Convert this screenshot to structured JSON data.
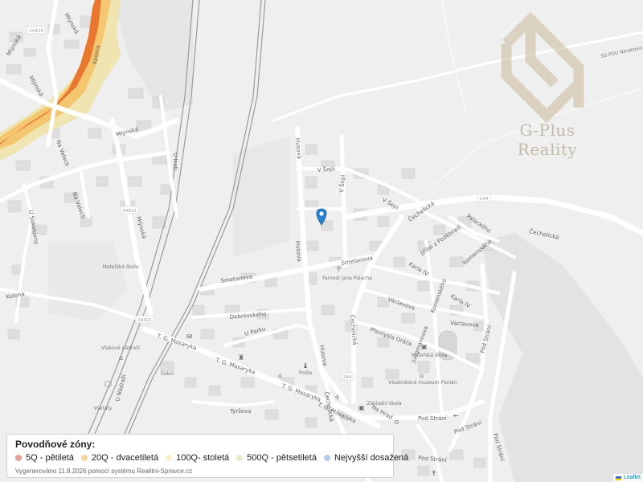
{
  "legend": {
    "title": "Povodňové zóny:",
    "items": [
      {
        "label": "5Q - pětiletá",
        "color": "#e8a19a"
      },
      {
        "label": "20Q - dvacetiletá",
        "color": "#f3d9a0"
      },
      {
        "label": "100Q- stoletá",
        "color": "#f6efc9"
      },
      {
        "label": "500Q - pětsetiletá",
        "color": "#e8e8c7"
      },
      {
        "label": "Nejvyšší dosažená",
        "color": "#b9c9ec"
      }
    ],
    "footer": "Vygenerováno 11.8.2026 pomocí systému Realitni-Spravce.cz"
  },
  "attribution": {
    "label": "Leaflet"
  },
  "logo": {
    "text": "G-Plus Reality",
    "color": "#c9ba9a"
  },
  "map": {
    "marker_icon": "map-pin-icon",
    "colors": {
      "flood_5q": "#e8782f",
      "flood_20q": "#f3c66f",
      "flood_100q": "#f0e3a8",
      "road": "#ffffff",
      "railway": "#9a9a9a"
    },
    "streets": {
      "mlynska": "Mlýnská",
      "mlynska2": "Mlýnská",
      "mlynska3": "Mlýnská",
      "mlynska4": "Mlýnská",
      "na_valech": "Na Valech",
      "u_sokolovny": "U Sokolovny",
      "u_trati": "U trati",
      "hustova": "Husova",
      "v_sepi": "V Šepi",
      "v_sepi2": "V Šepi",
      "v_sepi3": "V Šepi",
      "smetanova": "Smetanova",
      "smetanova2": "Smetanova",
      "dobrovskeho": "Dobrovského",
      "u_parku": "U Parku",
      "tg_masaryka": "T. G. Masaryka",
      "tg_masaryka2": "T. G. Masaryka",
      "tg_masaryka3": "T. G. Masaryka",
      "tyrsova": "Tyršova",
      "u_nadrazi": "U Nádraží",
      "husova2": "Husova",
      "cechelicka": "Čechelická",
      "cechelicka2": "Čechelická",
      "cechelicka3": "Čechelická",
      "jiriho_z_podebrad": "Jiřího z Poděbrad",
      "palackeho": "Palackého",
      "karla_iv": "Karla IV",
      "karla_iv2": "Karla IV",
      "komenskeho": "Komenského",
      "komenskeho2": "Komenského",
      "vaclavova": "Václavova",
      "vaclavova2": "Václavova",
      "premysla_oracce": "Přemysla Oráče",
      "jungmannova": "Jungmannova",
      "pod_strani": "Pod Strání",
      "pod_strani2": "Pod Strání",
      "pod_strani3": "Pod Strání",
      "na_hrad": "Na Hrad",
      "kolona": "Kolona",
      "kolona2": "Kolona"
    },
    "road_numbers": {
      "r24423": "24423",
      "r24422": "24422",
      "r24421": "24421",
      "r244": "244",
      "r244b": "244"
    },
    "pois": {
      "materska1": "Mateřská škola",
      "farnost": "Farnost Jana Palacha",
      "materska2": "Mateřská škola",
      "muzeum": "Vlastivědné muzeum Florián",
      "zakladni": "Základní škola",
      "posta": "Pošta",
      "vlakova": "Vlakové nádraží",
      "station": "Všetaty",
      "sokol": "Sokol"
    },
    "top_right_label": "50 POU Neratovice"
  }
}
